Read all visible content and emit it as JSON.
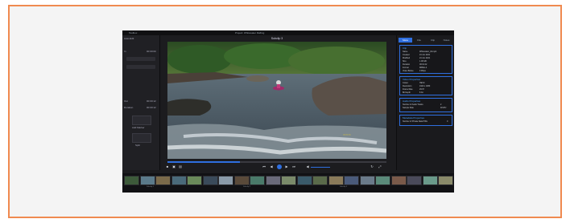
{
  "app": {
    "window_title": "Project: Whitewater Rafting",
    "left_tab": "Toolbox",
    "left_sub": "Auto-Edit",
    "video_title": "Subclip 3"
  },
  "left_panel": {
    "rows": [
      {
        "label": "In",
        "value": "00:00:00"
      },
      {
        "label": "Out",
        "value": "00:00:12"
      },
      {
        "label": "Duration",
        "value": "00:00:12"
      }
    ],
    "buttons": [
      "Add Marker",
      "Split"
    ]
  },
  "inspector": {
    "tabs": [
      "Meta",
      "File",
      "Clip",
      "Notes"
    ],
    "active_tab": 0,
    "sections": [
      {
        "title": "Clip",
        "rows": [
          [
            "Name",
            "Whitewater_04.mp4"
          ],
          [
            "Created",
            "24 Jun 2021"
          ],
          [
            "Modified",
            "24 Jun 2021"
          ],
          [
            "Size",
            "1.08 GB"
          ],
          [
            "Duration",
            "00:01:22"
          ],
          [
            "Format",
            "MPEG-4"
          ],
          [
            "Video Bitrate",
            "9 Mbps"
          ]
        ]
      },
      {
        "title": "Video Properties",
        "rows": [
          [
            "Codec",
            "HEVC"
          ],
          [
            "Resolution",
            "1920 x 1080"
          ],
          [
            "Frame Rate",
            "29.97"
          ],
          [
            "Bit Depth",
            "8 bit"
          ]
        ]
      },
      {
        "title": "Audio Properties",
        "rows": [
          [
            "Number of Audio Tracks",
            "2"
          ],
          [
            "Sample Rate",
            "48 kHz"
          ]
        ]
      },
      {
        "title": "Metadata Properties",
        "rows": [
          [
            "Number of Private Data PIDs",
            "0"
          ]
        ]
      }
    ]
  },
  "filmstrip": {
    "thumbs": [
      "#3d5a3a",
      "#5b7a8a",
      "#7a6a4a",
      "#4a6a7a",
      "#6a8a5a",
      "#3a4a5a",
      "#8a9aa8",
      "#5a4a3a",
      "#4a7a6a",
      "#6a6a7a",
      "#7a8a6a",
      "#3a5a6a",
      "#5a6a4a",
      "#8a7a5a",
      "#4a5a7a",
      "#6a7a8a",
      "#5a8a7a",
      "#7a5a4a",
      "#4a4a5a",
      "#6a9a8a",
      "#8a8a6a"
    ],
    "labels": [
      "Subclip 1",
      "Subclip 2",
      "Subclip 3"
    ]
  },
  "colors": {
    "accent": "#2f6fe0",
    "frame": "#f08a50"
  }
}
